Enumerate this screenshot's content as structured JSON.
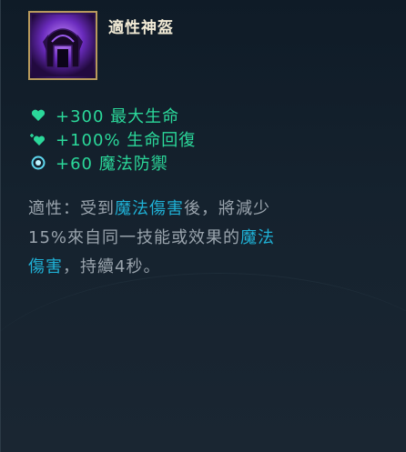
{
  "item": {
    "name": "適性神盔",
    "icon": "purple-helm-icon"
  },
  "stats": [
    {
      "icon": "heart-icon",
      "text": "+300 最大生命"
    },
    {
      "icon": "heart-regen-icon",
      "text": "+100% 生命回復"
    },
    {
      "icon": "magic-resist-icon",
      "text": "+60 魔法防禦"
    }
  ],
  "passive": {
    "label": "適性：",
    "part1": "受到",
    "hl1": "魔法傷害",
    "part2": "後，將減少",
    "part3": "15%來自同一技能或效果的",
    "hl2": "魔法",
    "hl3": "傷害",
    "part4": "，持續4秒。"
  },
  "colors": {
    "stat_text": "#2bd89a",
    "highlight": "#1fb1d6",
    "body_text": "#9aa4ad",
    "title": "#f2ebd6",
    "icon_border": "#b89a5c"
  }
}
